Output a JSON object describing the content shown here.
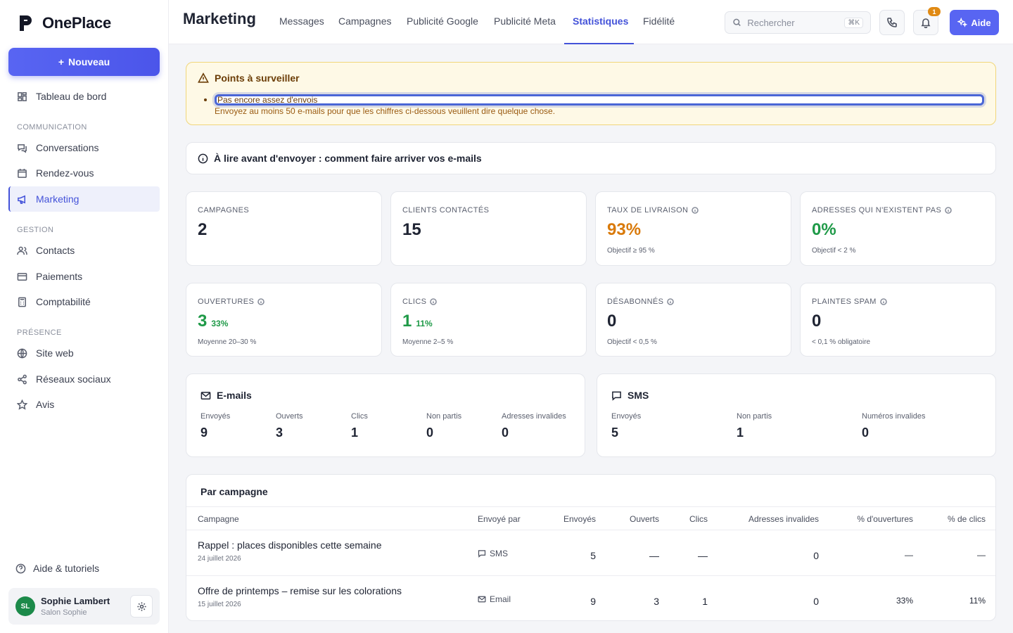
{
  "sidebar": {
    "logo_text": "OnePlace",
    "new_label": "Nouveau",
    "items": [
      {
        "label": "Tableau de bord"
      },
      {
        "label": "Conversations"
      },
      {
        "label": "Rendez-vous"
      },
      {
        "label": "Marketing"
      },
      {
        "label": "Contacts"
      },
      {
        "label": "Paiements"
      },
      {
        "label": "Comptabilité"
      },
      {
        "label": "Site web"
      },
      {
        "label": "Réseaux sociaux"
      },
      {
        "label": "Avis"
      }
    ],
    "sections": {
      "communication": "COMMUNICATION",
      "gestion": "GESTION",
      "presence": "PRÉSENCE"
    },
    "help_label": "Aide & tutoriels",
    "user": {
      "initials": "SL",
      "name": "Sophie Lambert",
      "business": "Salon Sophie"
    }
  },
  "header": {
    "title": "Marketing",
    "tabs": [
      {
        "label": "Messages"
      },
      {
        "label": "Campagnes"
      },
      {
        "label": "Publicité Google"
      },
      {
        "label": "Publicité Meta"
      },
      {
        "label": "Statistiques"
      },
      {
        "label": "Fidélité"
      }
    ],
    "active_tab": "Statistiques",
    "search_placeholder": "Rechercher",
    "search_shortcut": "⌘K",
    "notifications_count": "1",
    "help_label": "Aide"
  },
  "alert": {
    "title": "Points à surveiller",
    "item_title": "Pas encore assez d'envois",
    "item_text": "Envoyez au moins 50 e-mails pour que les chiffres ci-dessous veuillent dire quelque chose."
  },
  "info_banner": "À lire avant d'envoyer : comment faire arriver vos e-mails",
  "kpis": [
    {
      "label": "CAMPAGNES",
      "value": "2",
      "pct": "",
      "sub": ""
    },
    {
      "label": "CLIENTS CONTACTÉS",
      "value": "15",
      "pct": "",
      "sub": ""
    },
    {
      "label": "TAUX DE LIVRAISON",
      "value": "93%",
      "pct": "",
      "sub": "Objectif ≥ 95 %"
    },
    {
      "label": "ADRESSES QUI N'EXISTENT PAS",
      "value": "0%",
      "pct": "",
      "sub": "Objectif < 2 %"
    },
    {
      "label": "OUVERTURES",
      "value": "3",
      "pct": "33%",
      "sub": "Moyenne 20–30 %"
    },
    {
      "label": "CLICS",
      "value": "1",
      "pct": "11%",
      "sub": "Moyenne 2–5 %"
    },
    {
      "label": "DÉSABONNÉS",
      "value": "0",
      "pct": "",
      "sub": "Objectif < 0,5 %"
    },
    {
      "label": "PLAINTES SPAM",
      "value": "0",
      "pct": "",
      "sub": "< 0,1 % obligatoire"
    }
  ],
  "emails": {
    "title": "E-mails",
    "stats": [
      {
        "label": "Envoyés",
        "value": "9"
      },
      {
        "label": "Ouverts",
        "value": "3"
      },
      {
        "label": "Clics",
        "value": "1"
      },
      {
        "label": "Non partis",
        "value": "0"
      },
      {
        "label": "Adresses invalides",
        "value": "0"
      }
    ]
  },
  "sms": {
    "title": "SMS",
    "stats": [
      {
        "label": "Envoyés",
        "value": "5"
      },
      {
        "label": "Non partis",
        "value": "1"
      },
      {
        "label": "Numéros invalides",
        "value": "0"
      }
    ]
  },
  "campaigns": {
    "title": "Par campagne",
    "columns": [
      "Campagne",
      "Envoyé par",
      "Envoyés",
      "Ouverts",
      "Clics",
      "Adresses invalides",
      "% d'ouvertures",
      "% de clics"
    ],
    "rows": [
      {
        "name": "Rappel : places disponibles cette semaine",
        "date": "24 juillet 2026",
        "channel": "SMS",
        "sent": "5",
        "opened": "—",
        "clicks": "—",
        "invalid": "0",
        "open_rate": "—",
        "click_rate": "—"
      },
      {
        "name": "Offre de printemps – remise sur les colorations",
        "date": "15 juillet 2026",
        "channel": "Email",
        "sent": "9",
        "opened": "3",
        "clicks": "1",
        "invalid": "0",
        "open_rate": "33%",
        "click_rate": "11%"
      }
    ]
  },
  "colors": {
    "accent": "#4352d9",
    "good": "#1f9a48",
    "warning": "#d97a0b",
    "bad": "#d82b2b"
  }
}
